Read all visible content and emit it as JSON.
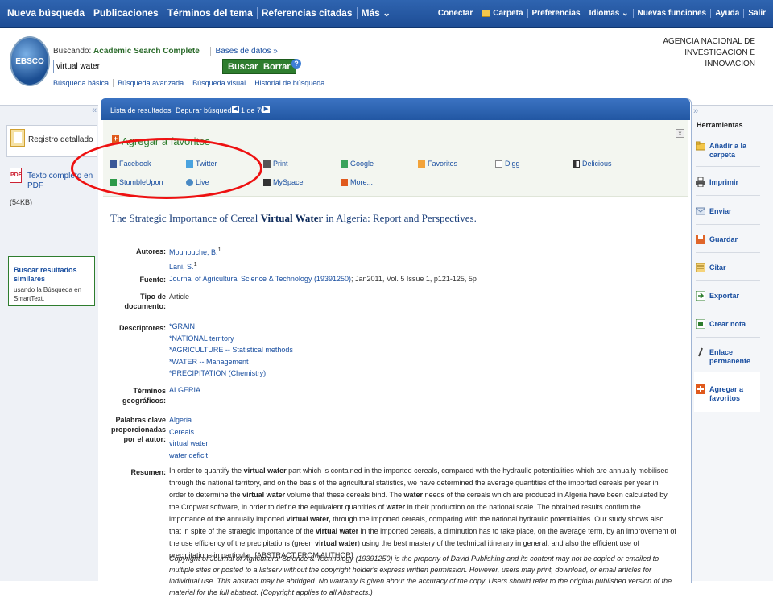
{
  "topnav": [
    "Nueva búsqueda",
    "Publicaciones",
    "Términos del tema",
    "Referencias citadas",
    "Más ⌄"
  ],
  "topright": [
    "Conectar",
    "Carpeta",
    "Preferencias",
    "Idiomas ⌄",
    "Nuevas funciones",
    "Ayuda",
    "Salir"
  ],
  "header": {
    "logo_text": "EBSCO",
    "searching_label": "Buscando:",
    "database": "Academic Search Complete",
    "databases_link": "Bases de datos »",
    "query": "virtual water",
    "search_button": "Buscar",
    "clear_button": "Borrar",
    "help": "?",
    "sublinks": [
      "Búsqueda básica",
      "Búsqueda avanzada",
      "Búsqueda visual",
      "Historial de búsqueda"
    ],
    "agency": [
      "AGENCIA NACIONAL DE",
      "INVESTIGACION E",
      "INNOVACION"
    ]
  },
  "left": {
    "collapse": "«",
    "detail_record": "Registro detallado",
    "pdf_label": "Texto completo en PDF",
    "pdf_size": "(54KB)",
    "similar_title": "Buscar resultados similares",
    "similar_desc": "usando la Búsqueda en SmartText."
  },
  "resultbar": {
    "results_list": "Lista de resultados",
    "refine": "Depurar búsqueda",
    "page": "1 de 70"
  },
  "favorites": {
    "title": "Agregar a favoritos",
    "close": "x",
    "items": [
      "Facebook",
      "Twitter",
      "Print",
      "Google",
      "Favorites",
      "Digg",
      "Delicious",
      "StumbleUpon",
      "Live",
      "MySpace",
      "More..."
    ],
    "colors": {
      "facebook": "#3b5998",
      "twitter": "#4aa3df",
      "print": "#555555",
      "google": "#3aa35a",
      "favorites": "#f2a33a",
      "digg": "#888888",
      "delicious": "#333333",
      "stumbleupon": "#2e9a48",
      "live": "#4a8ac4",
      "myspace": "#333333",
      "more": "#e05a1d"
    }
  },
  "article": {
    "title_pre": "The Strategic Importance of Cereal ",
    "title_bold": "Virtual Water",
    "title_post": " in Algeria: Report and Perspectives.",
    "authors_label": "Autores:",
    "authors": [
      "Mouhouche, B.",
      "Lani, S."
    ],
    "author_sup": "1",
    "source_label": "Fuente:",
    "source_link": "Journal of Agricultural Science & Technology (19391250)",
    "source_rest": "; Jan2011, Vol. 5 Issue 1, p121-125, 5p",
    "doctype_label_1": "Tipo de",
    "doctype_label_2": "documento:",
    "doctype": "Article",
    "descriptors_label": "Descriptores:",
    "descriptors": [
      "*GRAIN",
      "*NATIONAL territory",
      "*AGRICULTURE -- Statistical methods",
      "*WATER -- Management",
      "*PRECIPITATION (Chemistry)"
    ],
    "geo_label_1": "Términos",
    "geo_label_2": "geográficos:",
    "geo": "ALGERIA",
    "keywords_label_1": "Palabras clave",
    "keywords_label_2": "proporcionadas",
    "keywords_label_3": "por el autor:",
    "keywords": [
      "Algeria",
      "Cereals",
      "virtual water",
      "water deficit"
    ],
    "abstract_label": "Resumen:",
    "copyright": "Copyright of Journal of Agricultural Science & Technology (19391250) is the property of David Publishing and its content may not be copied or emailed to multiple sites or posted to a listserv without the copyright holder's express written permission. However, users may print, download, or email articles for individual use. This abstract may be abridged. No warranty is given about the accuracy of the copy. Users should refer to the original published version of the material for the full abstract. (Copyright applies to all Abstracts.)"
  },
  "abstract_parts": [
    {
      "t": "In order to quantify the ",
      "b": false
    },
    {
      "t": "virtual water",
      "b": true
    },
    {
      "t": " part which is contained in the imported cereals, compared with the hydraulic potentialities which are annually mobilised through the national territory, and on the basis of the agricultural statistics, we have determined the average quantities of the imported cereals per year in order to determine the ",
      "b": false
    },
    {
      "t": "virtual water",
      "b": true
    },
    {
      "t": " volume that these cereals bind. The ",
      "b": false
    },
    {
      "t": "water",
      "b": true
    },
    {
      "t": " needs of the cereals which are produced in Algeria have been calculated by the Cropwat software, in order to define the equivalent quantities of ",
      "b": false
    },
    {
      "t": "water",
      "b": true
    },
    {
      "t": " in their production on the national scale. The obtained results confirm the importance of the annually imported ",
      "b": false
    },
    {
      "t": "virtual water,",
      "b": true
    },
    {
      "t": " through the imported cereals, comparing with the national hydraulic potentialities. Our study shows also that in spite of the strategic importance of the ",
      "b": false
    },
    {
      "t": "virtual water",
      "b": true
    },
    {
      "t": " in the imported cereals, a diminution has to take place, on the average term, by an improvement of the use efficiency of the precipitations (green ",
      "b": false
    },
    {
      "t": "virtual water",
      "b": true
    },
    {
      "t": ") using the best mastery of the technical itinerary in general, and also the efficient use of precipitations in particular. [ABSTRACT FROM AUTHOR]",
      "b": false
    }
  ],
  "tools": {
    "title": "Herramientas",
    "items": [
      "Añadir a la carpeta",
      "Imprimir",
      "Enviar",
      "Guardar",
      "Citar",
      "Exportar",
      "Crear nota",
      "Enlace permanente",
      "Agregar a favoritos"
    ],
    "collapse": "»"
  },
  "annotation_color": "#ee1111"
}
